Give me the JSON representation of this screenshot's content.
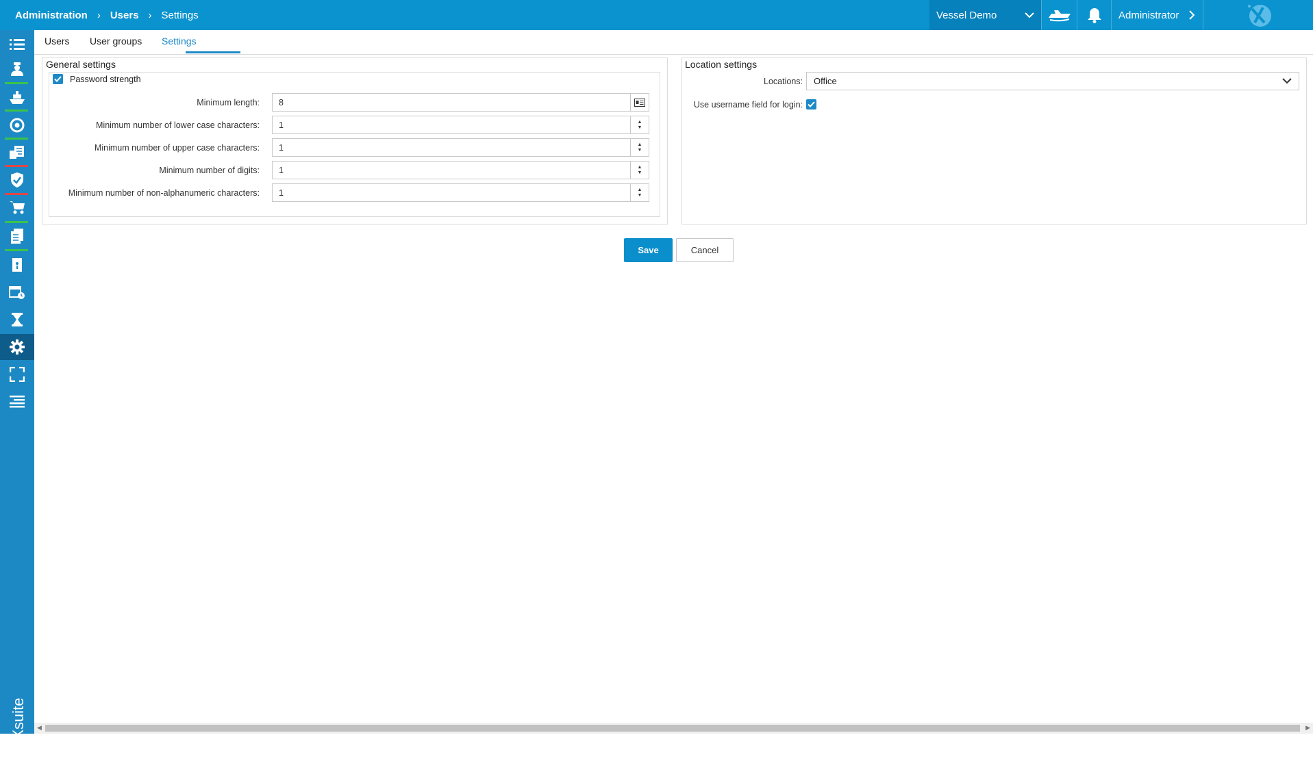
{
  "header": {
    "breadcrumb": [
      "Administration",
      "Users",
      "Settings"
    ],
    "vessel": "Vessel Demo",
    "user": "Administrator"
  },
  "sidebar": {
    "items": [
      {
        "icon": "list-icon"
      },
      {
        "icon": "crew-icon",
        "bar": "#3cc24a"
      },
      {
        "icon": "vessel-icon",
        "bar": "#3cc24a"
      },
      {
        "icon": "lifebuoy-icon",
        "bar": "#3cc24a"
      },
      {
        "icon": "documents-icon",
        "bar": "#e04646"
      },
      {
        "icon": "shield-check-icon",
        "bar": "#e04646"
      },
      {
        "icon": "cart-icon",
        "bar": "#3cc24a"
      },
      {
        "icon": "files-icon",
        "bar": "#3cc24a"
      },
      {
        "icon": "report-icon"
      },
      {
        "icon": "calendar-icon"
      },
      {
        "icon": "hourglass-icon"
      },
      {
        "icon": "gear-icon",
        "active": true
      },
      {
        "icon": "fullscreen-icon"
      },
      {
        "icon": "menu-icon"
      }
    ],
    "brand": "MXsuite"
  },
  "tabs": [
    {
      "label": "Users"
    },
    {
      "label": "User groups"
    },
    {
      "label": "Settings",
      "active": true
    }
  ],
  "general": {
    "title": "General settings",
    "password_strength": {
      "label": "Password strength",
      "checked": true
    },
    "fields": [
      {
        "label": "Minimum length:",
        "value": "8"
      },
      {
        "label": "Minimum number of lower case characters:",
        "value": "1"
      },
      {
        "label": "Minimum number of upper case characters:",
        "value": "1"
      },
      {
        "label": "Minimum number of digits:",
        "value": "1"
      },
      {
        "label": "Minimum number of non-alphanumeric characters:",
        "value": "1"
      }
    ]
  },
  "location": {
    "title": "Location settings",
    "locations_label": "Locations:",
    "locations_value": "Office",
    "username_label": "Use username field for login:",
    "username_checked": true
  },
  "buttons": {
    "save": "Save",
    "cancel": "Cancel"
  },
  "colors": {
    "accent": "#0a93cf",
    "sidebar": "#1d89c4",
    "green": "#3cc24a",
    "red": "#e04646"
  }
}
